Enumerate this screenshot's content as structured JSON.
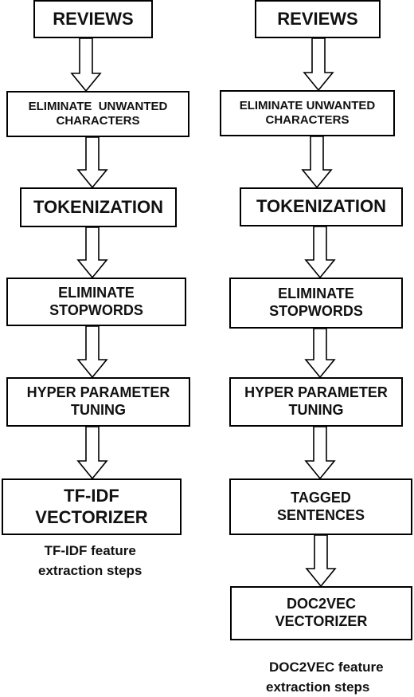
{
  "left_flow": {
    "steps": [
      {
        "lines": [
          "REVIEWS"
        ]
      },
      {
        "lines": [
          "ELIMINATE  UNWANTED",
          "CHARACTERS"
        ]
      },
      {
        "lines": [
          "TOKENIZATION"
        ]
      },
      {
        "lines": [
          "ELIMINATE",
          "STOPWORDS"
        ]
      },
      {
        "lines": [
          "HYPER PARAMETER",
          "TUNING"
        ]
      },
      {
        "lines": [
          "TF-IDF",
          "VECTORIZER"
        ]
      }
    ],
    "caption": [
      "TF-IDF feature",
      "extraction steps"
    ]
  },
  "right_flow": {
    "steps": [
      {
        "lines": [
          "REVIEWS"
        ]
      },
      {
        "lines": [
          "ELIMINATE UNWANTED",
          "CHARACTERS"
        ]
      },
      {
        "lines": [
          "TOKENIZATION"
        ]
      },
      {
        "lines": [
          "ELIMINATE",
          "STOPWORDS"
        ]
      },
      {
        "lines": [
          "HYPER PARAMETER",
          "TUNING"
        ]
      },
      {
        "lines": [
          "TAGGED",
          "SENTENCES"
        ]
      },
      {
        "lines": [
          "DOC2VEC",
          "VECTORIZER"
        ]
      }
    ],
    "caption": [
      "DOC2VEC feature",
      "extraction steps"
    ]
  }
}
